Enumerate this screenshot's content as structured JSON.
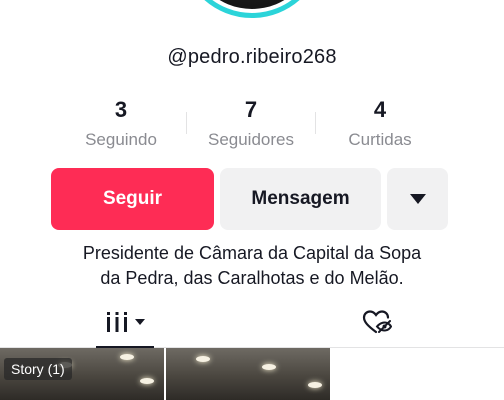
{
  "profile": {
    "username": "@pedro.ribeiro268",
    "bio_line1": "Presidente de Câmara da Capital da Sopa",
    "bio_line2": "da Pedra, das Caralhotas e do Melão."
  },
  "stats": {
    "following_count": "3",
    "following_label": "Seguindo",
    "followers_count": "7",
    "followers_label": "Seguidores",
    "likes_count": "4",
    "likes_label": "Curtidas"
  },
  "actions": {
    "follow_label": "Seguir",
    "message_label": "Mensagem",
    "more_icon": "caret-down-icon"
  },
  "tabs": [
    {
      "name": "videos",
      "icon": "grid-bars-icon",
      "active": true
    },
    {
      "name": "liked",
      "icon": "hidden-heart-icon",
      "active": false
    }
  ],
  "grid": {
    "items": [
      {
        "badge": "Story (1)"
      },
      {
        "badge": ""
      }
    ]
  },
  "colors": {
    "accent": "#fe2c55",
    "avatar_ring": "#2bd4d9",
    "secondary_text": "#8a8b91"
  }
}
